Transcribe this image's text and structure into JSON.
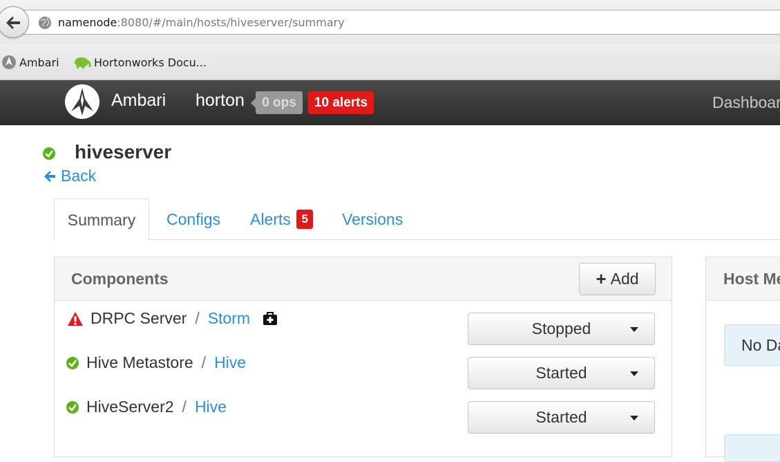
{
  "browser": {
    "url_host": "namenode",
    "url_rest": ":8080/#/main/hosts/hiveserver/summary",
    "bookmarks": [
      {
        "label": "Ambari"
      },
      {
        "label": "Hortonworks Docu..."
      }
    ]
  },
  "navbar": {
    "brand": "Ambari",
    "cluster": "horton",
    "ops_badge": "0 ops",
    "alerts_badge": "10 alerts",
    "dashboard": "Dashboar"
  },
  "host": {
    "name": "hiveserver",
    "back_label": "Back",
    "status_color": "#5cb317"
  },
  "tabs": [
    {
      "label": "Summary",
      "active": true
    },
    {
      "label": "Configs"
    },
    {
      "label": "Alerts",
      "badge": "5"
    },
    {
      "label": "Versions"
    }
  ],
  "components_panel": {
    "title": "Components",
    "add_label": "Add",
    "rows": [
      {
        "name": "DRPC Server",
        "service": "Storm",
        "status": "Stopped",
        "status_icon": "warning-icon",
        "maintenance_icon": "medkit-icon"
      },
      {
        "name": "Hive Metastore",
        "service": "Hive",
        "status": "Started",
        "status_icon": "check-circle-icon"
      },
      {
        "name": "HiveServer2",
        "service": "Hive",
        "status": "Started",
        "status_icon": "check-circle-icon"
      }
    ],
    "separator": "/"
  },
  "metrics_panel": {
    "title": "Host Me",
    "no_data": "No Da"
  },
  "colors": {
    "link": "#2a8fd4",
    "alert_red": "#e0191b",
    "ok_green": "#5cb317",
    "navbar": "#333333"
  }
}
